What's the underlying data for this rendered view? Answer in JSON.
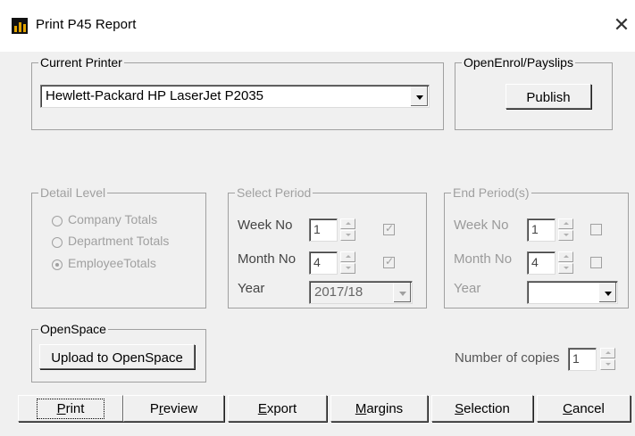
{
  "window": {
    "title": "Print P45 Report",
    "close_glyph": "✕"
  },
  "current_printer": {
    "label": "Current Printer",
    "value": "Hewlett-Packard HP LaserJet P2035"
  },
  "openenrol": {
    "label": "OpenEnrol/Payslips",
    "publish": "Publish"
  },
  "detail_level": {
    "label": "Detail Level",
    "options": [
      "Company Totals",
      "Department Totals",
      "EmployeeTotals"
    ],
    "selected": "EmployeeTotals"
  },
  "select_period": {
    "label": "Select Period",
    "week_label": "Week No",
    "week_value": "1",
    "week_checked": true,
    "month_label": "Month No",
    "month_value": "4",
    "month_checked": true,
    "year_label": "Year",
    "year_value": "2017/18"
  },
  "end_period": {
    "label": "End Period(s)",
    "week_label": "Week No",
    "week_value": "1",
    "week_checked": false,
    "month_label": "Month No",
    "month_value": "4",
    "month_checked": false,
    "year_label": "Year",
    "year_value": ""
  },
  "openspace": {
    "label": "OpenSpace",
    "upload": "Upload to OpenSpace"
  },
  "copies": {
    "label": "Number of copies",
    "value": "1"
  },
  "buttons": {
    "print_u": "P",
    "print_rest": "rint",
    "preview_pre": "P",
    "preview_u": "r",
    "preview_rest": "eview",
    "export_u": "E",
    "export_rest": "xport",
    "margins_u": "M",
    "margins_rest": "argins",
    "selection_u": "S",
    "selection_rest": "election",
    "cancel_u": "C",
    "cancel_rest": "ancel"
  }
}
